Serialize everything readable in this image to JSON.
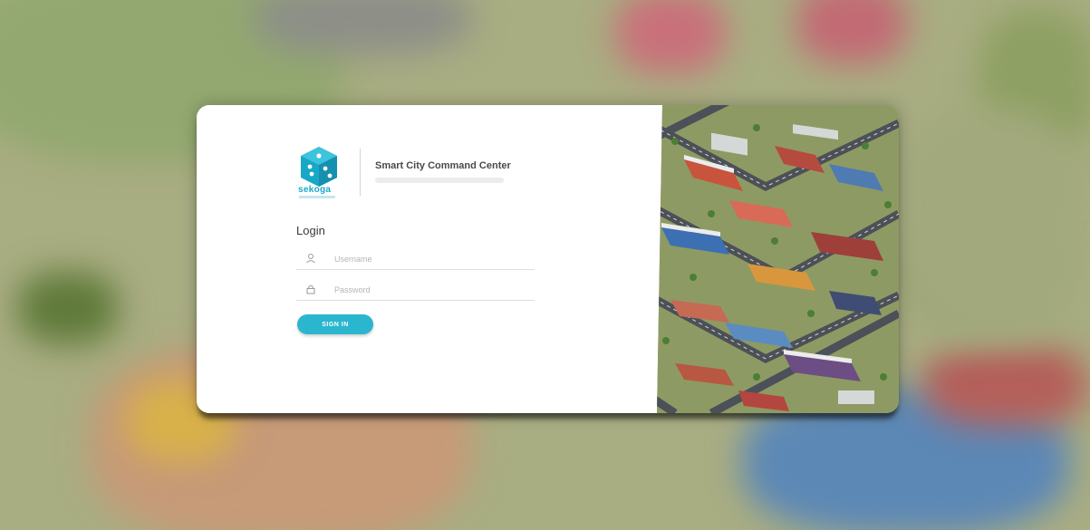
{
  "brand": {
    "logo_text": "sekoga",
    "app_title": "Smart City Command Center"
  },
  "login": {
    "heading": "Login",
    "username_placeholder": "Username",
    "password_placeholder": "Password",
    "signin_label": "SIGN IN"
  },
  "icons": {
    "logo": "cube-logo-icon",
    "username": "user-icon",
    "password": "lock-icon"
  },
  "colors": {
    "accent": "#2bb6cf",
    "logo": "#1aa9c9",
    "card": "#ffffff"
  }
}
